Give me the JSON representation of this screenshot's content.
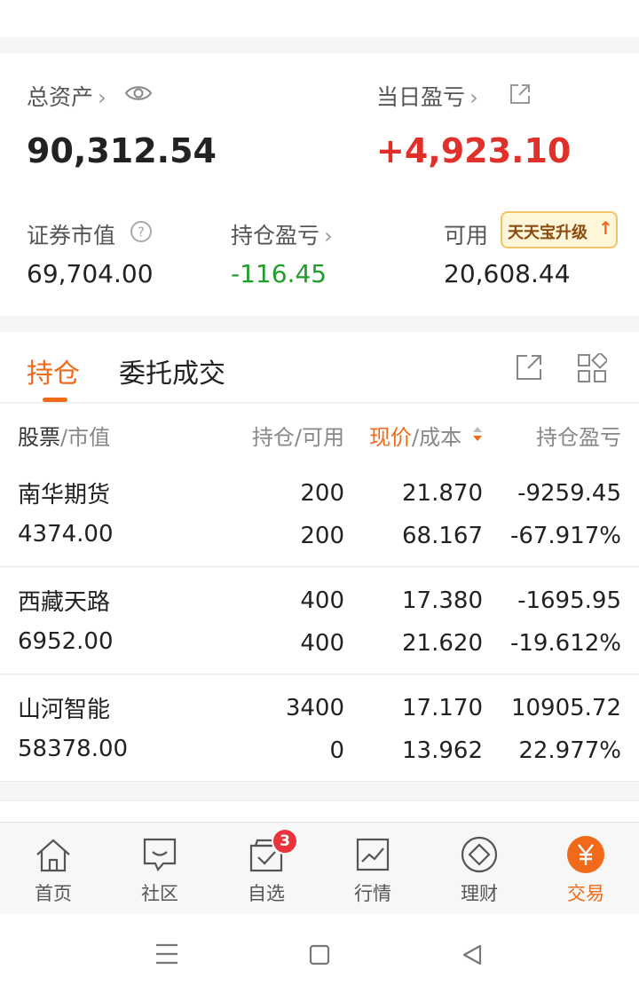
{
  "summary": {
    "total_assets_label": "总资产",
    "total_assets_value": "90,312.54",
    "daily_pnl_label": "当日盈亏",
    "daily_pnl_value": "+4,923.10",
    "market_value_label": "证券市值",
    "market_value": "69,704.00",
    "position_pnl_label": "持仓盈亏",
    "position_pnl": "-116.45",
    "available_label": "可用",
    "available_value": "20,608.44",
    "upgrade_badge": "天天宝升级"
  },
  "tabs": [
    {
      "label": "持仓",
      "active": true
    },
    {
      "label": "委托成交",
      "active": false
    }
  ],
  "table": {
    "headers": {
      "stock": "股票",
      "stock_sub": "/市值",
      "position": "持仓/可用",
      "price_active": "现价",
      "price_sub": "/成本",
      "pnl": "持仓盈亏"
    },
    "rows": [
      {
        "name": "南华期货",
        "market_value": "4374.00",
        "position": "200",
        "available": "200",
        "price": "21.870",
        "cost": "68.167",
        "pnl": "-9259.45",
        "pnl_pct": "-67.917%",
        "trend": "down"
      },
      {
        "name": "西藏天路",
        "market_value": "6952.00",
        "position": "400",
        "available": "400",
        "price": "17.380",
        "cost": "21.620",
        "pnl": "-1695.95",
        "pnl_pct": "-19.612%",
        "trend": "down"
      },
      {
        "name": "山河智能",
        "market_value": "58378.00",
        "position": "3400",
        "available": "0",
        "price": "17.170",
        "cost": "13.962",
        "pnl": "10905.72",
        "pnl_pct": "22.977%",
        "trend": "up"
      }
    ]
  },
  "nav": [
    {
      "label": "首页",
      "icon": "home-icon"
    },
    {
      "label": "社区",
      "icon": "chat-icon"
    },
    {
      "label": "自选",
      "icon": "watchlist-icon",
      "badge": "3"
    },
    {
      "label": "行情",
      "icon": "chart-icon"
    },
    {
      "label": "理财",
      "icon": "diamond-icon"
    },
    {
      "label": "交易",
      "icon": "yen-icon",
      "active": true
    }
  ],
  "colors": {
    "accent": "#f06a1a",
    "up": "#e0302a",
    "down": "#1f9e2a"
  }
}
